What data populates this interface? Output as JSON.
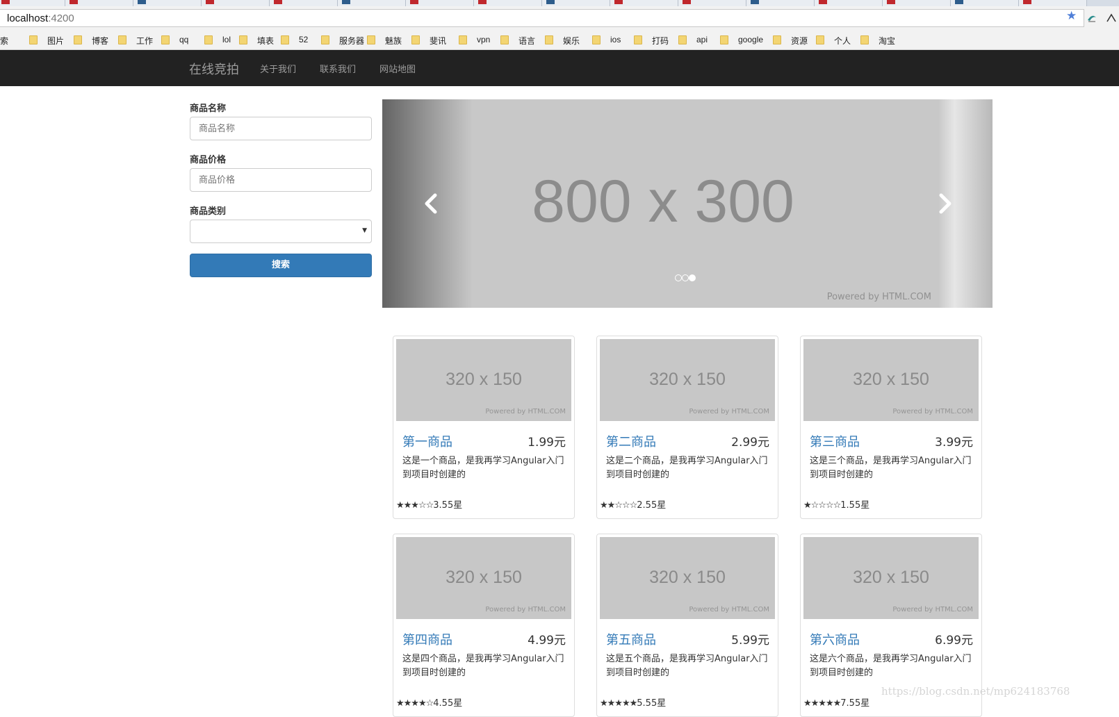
{
  "browser": {
    "address_host": "localhost",
    "address_port": ":4200",
    "bookmarks": [
      "搜索",
      "图片",
      "博客",
      "工作",
      "qq",
      "lol",
      "填表",
      "52",
      "服务器",
      "魅族",
      "斐讯",
      "vpn",
      "语言",
      "娱乐",
      "ios",
      "打码",
      "api",
      "google",
      "资源",
      "个人",
      "淘宝"
    ]
  },
  "navbar": {
    "brand": "在线竞拍",
    "links": [
      "关于我们",
      "联系我们",
      "网站地图"
    ]
  },
  "search_form": {
    "name_label": "商品名称",
    "name_placeholder": "商品名称",
    "price_label": "商品价格",
    "price_placeholder": "商品价格",
    "category_label": "商品类别",
    "category_value": "",
    "search_button": "搜索"
  },
  "carousel": {
    "image_text": "800 x 300",
    "powered_text": "Powered by HTML.COM",
    "slide_count": 3,
    "active_slide": 3
  },
  "products": [
    {
      "title": "第一商品",
      "price": "1.99元",
      "desc": "这是一个商品，是我再学习Angular入门到项目时创建的",
      "stars_filled": 3,
      "rating_text": "3.55星",
      "thumb_text": "320 x 150",
      "thumb_power": "Powered by HTML.COM"
    },
    {
      "title": "第二商品",
      "price": "2.99元",
      "desc": "这是二个商品，是我再学习Angular入门到项目时创建的",
      "stars_filled": 2,
      "rating_text": "2.55星",
      "thumb_text": "320 x 150",
      "thumb_power": "Powered by HTML.COM"
    },
    {
      "title": "第三商品",
      "price": "3.99元",
      "desc": "这是三个商品，是我再学习Angular入门到项目时创建的",
      "stars_filled": 1,
      "rating_text": "1.55星",
      "thumb_text": "320 x 150",
      "thumb_power": "Powered by HTML.COM"
    },
    {
      "title": "第四商品",
      "price": "4.99元",
      "desc": "这是四个商品，是我再学习Angular入门到项目时创建的",
      "stars_filled": 4,
      "rating_text": "4.55星",
      "thumb_text": "320 x 150",
      "thumb_power": "Powered by HTML.COM"
    },
    {
      "title": "第五商品",
      "price": "5.99元",
      "desc": "这是五个商品，是我再学习Angular入门到项目时创建的",
      "stars_filled": 5,
      "rating_text": "5.55星",
      "thumb_text": "320 x 150",
      "thumb_power": "Powered by HTML.COM"
    },
    {
      "title": "第六商品",
      "price": "6.99元",
      "desc": "这是六个商品，是我再学习Angular入门到项目时创建的",
      "stars_filled": 5,
      "rating_text": "7.55星",
      "thumb_text": "320 x 150",
      "thumb_power": "Powered by HTML.COM"
    }
  ],
  "watermark": "https://blog.csdn.net/mp624183768",
  "colors": {
    "navbar_bg": "#222222",
    "primary": "#337ab7",
    "link": "#337ab7",
    "placeholder_bg": "#c7c7c7"
  }
}
